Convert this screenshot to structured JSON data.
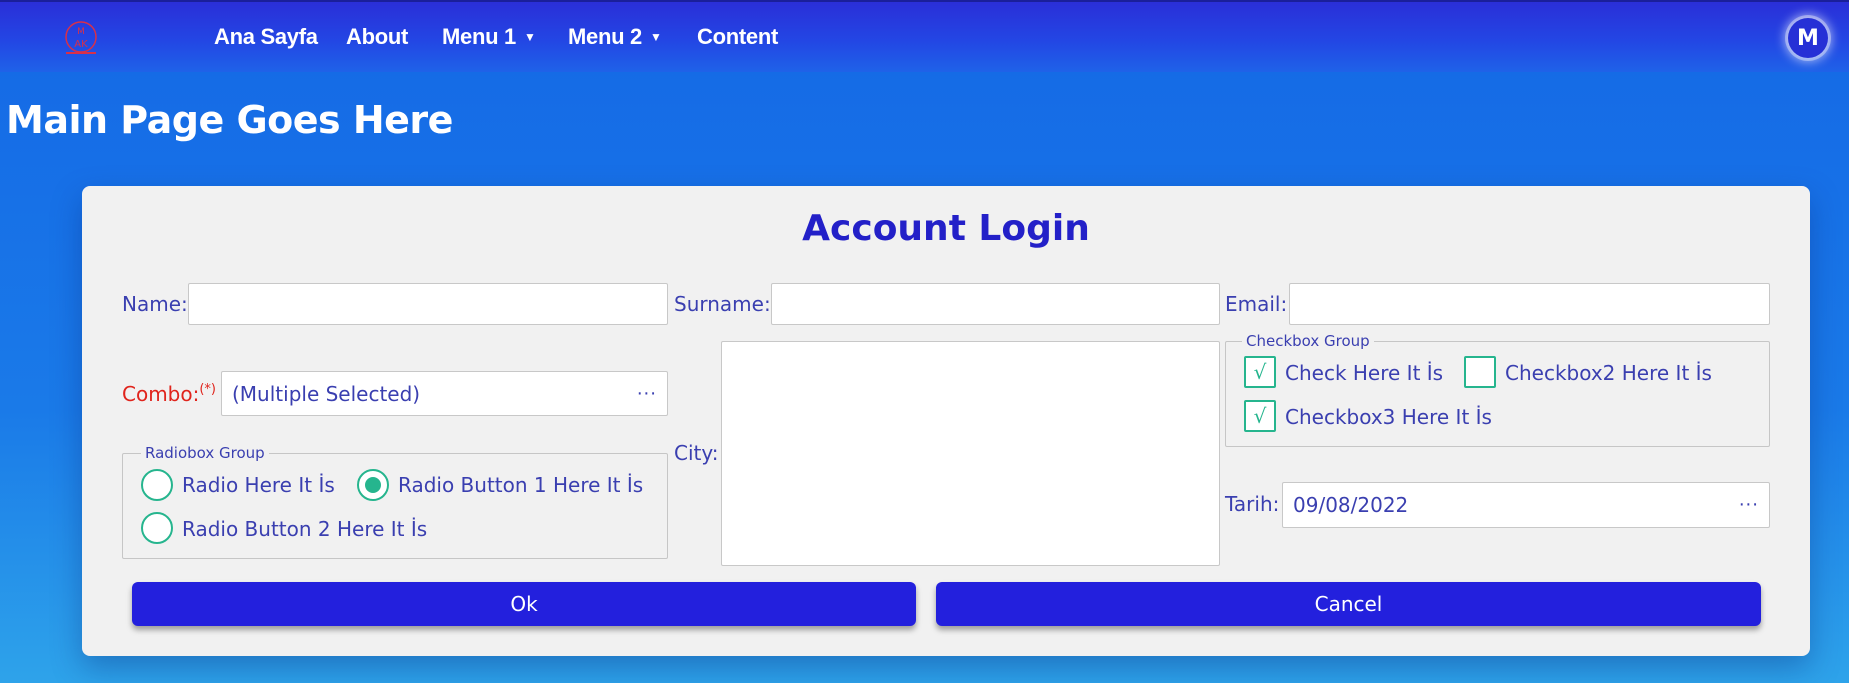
{
  "navbar": {
    "logo_text": [
      "M",
      "AK"
    ],
    "items": [
      {
        "label": "Ana Sayfa",
        "has_dropdown": false
      },
      {
        "label": "About",
        "has_dropdown": false
      },
      {
        "label": "Menu 1",
        "has_dropdown": true
      },
      {
        "label": "Menu 2",
        "has_dropdown": true
      },
      {
        "label": "Content",
        "has_dropdown": false
      }
    ],
    "caret": "▼",
    "avatar_initial": "M"
  },
  "page": {
    "title": "Main Page Goes Here"
  },
  "form": {
    "title": "Account Login",
    "name": {
      "label": "Name:",
      "value": ""
    },
    "surname": {
      "label": "Surname:",
      "value": ""
    },
    "email": {
      "label": "Email:",
      "value": ""
    },
    "combo": {
      "label": "Combo:",
      "required_marker": "(*)",
      "value": "(Multiple Selected)",
      "more_icon": "···"
    },
    "city": {
      "label": "City:",
      "value": ""
    },
    "radio_group": {
      "legend": "Radiobox Group",
      "options": [
        {
          "label": "Radio Here It İs",
          "selected": false
        },
        {
          "label": "Radio Button 1 Here It İs",
          "selected": true
        },
        {
          "label": "Radio Button 2 Here It İs",
          "selected": false
        }
      ]
    },
    "checkbox_group": {
      "legend": "Checkbox Group",
      "check_glyph": "√",
      "options": [
        {
          "label": "Check Here It İs",
          "checked": true
        },
        {
          "label": "Checkbox2 Here It İs",
          "checked": false
        },
        {
          "label": "Checkbox3 Here It İs",
          "checked": true
        }
      ]
    },
    "date": {
      "label": "Tarih:",
      "value": "09/08/2022",
      "more_icon": "···"
    },
    "ok_label": "Ok",
    "cancel_label": "Cancel"
  },
  "colors": {
    "navbar": "#2a2fd8",
    "background": "#1a7ae8",
    "accent": "#26b58e",
    "button": "#2320dd",
    "text": "#3a3fb0",
    "required": "#e0241c"
  }
}
